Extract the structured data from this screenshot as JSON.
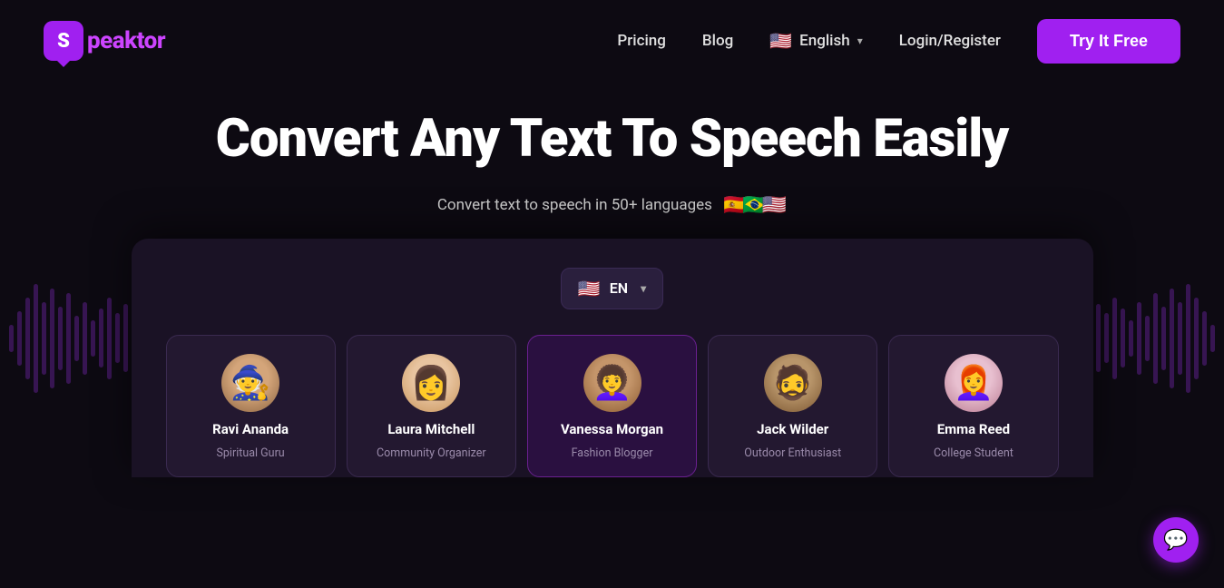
{
  "brand": {
    "logo_letter": "S",
    "name": "peaktor"
  },
  "navbar": {
    "pricing": "Pricing",
    "blog": "Blog",
    "language": "English",
    "login_register": "Login/Register",
    "try_free": "Try It Free"
  },
  "hero": {
    "title": "Convert Any Text To Speech Easily",
    "subtitle": "Convert text to speech in 50+ languages",
    "flags": [
      "🇪🇸",
      "🇧🇷",
      "🇺🇸"
    ]
  },
  "app": {
    "lang_selector": "EN",
    "voices": [
      {
        "name": "Ravi Ananda",
        "role": "Spiritual Guru",
        "avatar_type": "ravi"
      },
      {
        "name": "Laura Mitchell",
        "role": "Community Organizer",
        "avatar_type": "laura"
      },
      {
        "name": "Vanessa Morgan",
        "role": "Fashion Blogger",
        "avatar_type": "vanessa"
      },
      {
        "name": "Jack Wilder",
        "role": "Outdoor Enthusiast",
        "avatar_type": "jack"
      },
      {
        "name": "Emma Reed",
        "role": "College Student",
        "avatar_type": "emma"
      }
    ]
  },
  "chat": {
    "icon": "💬"
  }
}
